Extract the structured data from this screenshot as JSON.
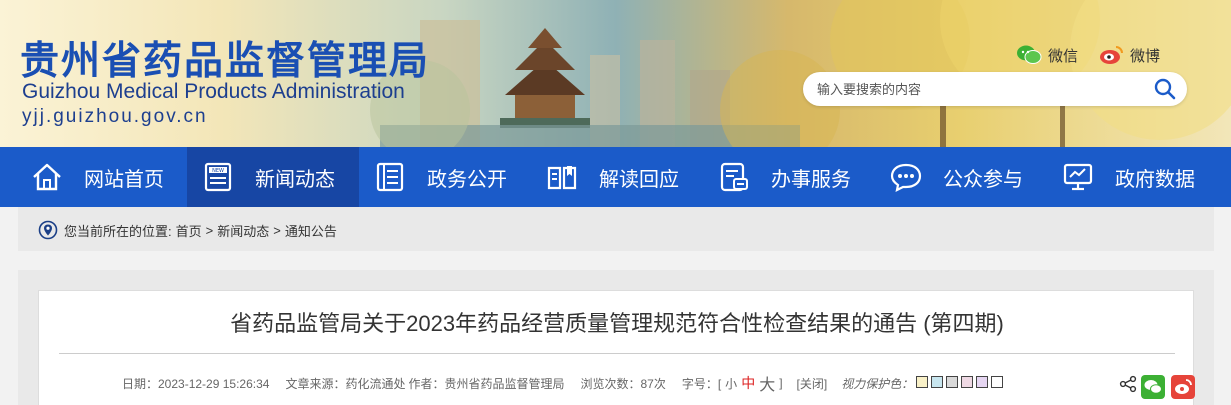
{
  "header": {
    "title_cn": "贵州省药品监督管理局",
    "title_en": "Guizhou Medical Products Administration",
    "url": "yjj.guizhou.gov.cn",
    "wechat_label": "微信",
    "weibo_label": "微博",
    "search_placeholder": "输入要搜索的内容"
  },
  "nav": {
    "items": [
      {
        "label": "网站首页",
        "icon": "home-icon"
      },
      {
        "label": "新闻动态",
        "icon": "news-icon"
      },
      {
        "label": "政务公开",
        "icon": "document-icon"
      },
      {
        "label": "解读回应",
        "icon": "book-icon"
      },
      {
        "label": "办事服务",
        "icon": "service-icon"
      },
      {
        "label": "公众参与",
        "icon": "chat-icon"
      },
      {
        "label": "政府数据",
        "icon": "monitor-icon"
      }
    ],
    "active_index": 1
  },
  "breadcrumb": {
    "prefix": "您当前所在的位置:",
    "items": [
      "首页",
      "新闻动态",
      "通知公告"
    ],
    "separator": ">"
  },
  "article": {
    "title": "省药品监管局关于2023年药品经营质量管理规范符合性检查结果的通告 (第四期)",
    "date": "日期：2023-12-29 15:26:34",
    "source": "文章来源：药化流通处",
    "author": "作者：贵州省药品监督管理局",
    "views": "浏览次数：87次",
    "font_label": "字号：[",
    "font_small": "小",
    "font_mid": "中",
    "font_big": "大",
    "font_end": "]",
    "close": "[关闭]",
    "eye_label": "视力保护色：",
    "swatches": [
      "#f9f1c8",
      "#c8e6ef",
      "#d9d9d9",
      "#efd9e4",
      "#e6d6f2",
      "#ffffff"
    ]
  },
  "colors": {
    "nav_bg": "#1b5bc9",
    "nav_active": "#1746a4",
    "brand_blue": "#1a4fb3",
    "wechat_green": "#3cb034",
    "weibo_red": "#e6443a"
  }
}
